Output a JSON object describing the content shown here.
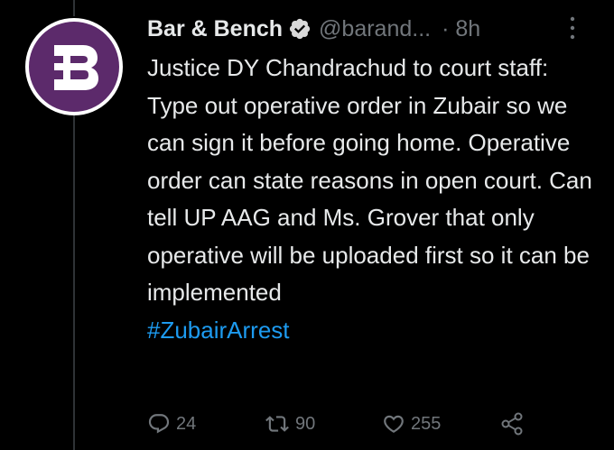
{
  "author": {
    "display_name": "Bar & Bench",
    "handle": "@barand...",
    "time": "· 8h",
    "avatar_letter": "B",
    "avatar_color": "#5c2a6b",
    "verified_icon": "verified-badge-icon"
  },
  "tweet": {
    "text": "Justice DY Chandrachud to court staff: Type out operative order in Zubair so we can sign it before going home. Operative order can state reasons in open court. Can tell UP AAG and Ms. Grover that only operative will be uploaded first so it can be implemented",
    "hashtag": "#ZubairArrest"
  },
  "actions": {
    "reply_count": "24",
    "retweet_count": "90",
    "like_count": "255",
    "reply_icon": "reply-icon",
    "retweet_icon": "retweet-icon",
    "like_icon": "heart-icon",
    "share_icon": "share-icon"
  },
  "colors": {
    "background": "#000000",
    "text": "#e7e9ea",
    "secondary": "#71767b",
    "link": "#1d9bf0"
  }
}
